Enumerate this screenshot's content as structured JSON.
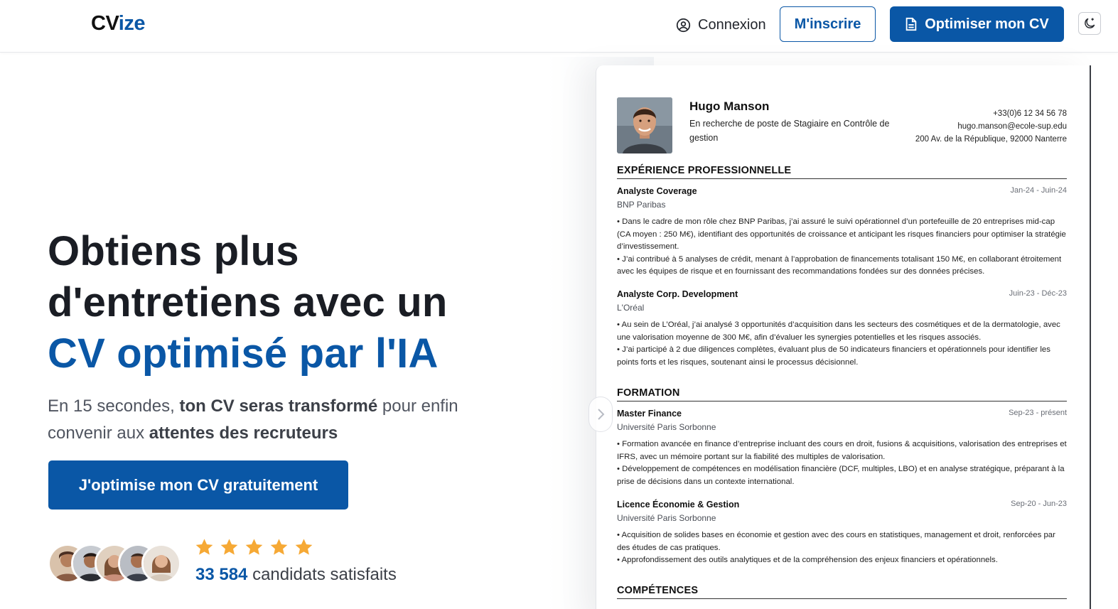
{
  "header": {
    "logo_main": "CV",
    "logo_accent": "ize",
    "login_label": "Connexion",
    "signup_label": "M'inscrire",
    "optimize_label": "Optimiser mon CV"
  },
  "hero": {
    "title_line1": "Obtiens plus",
    "title_line2": "d'entretiens avec un",
    "title_line3": "CV optimisé par l'IA",
    "sub_part1": "En 15 secondes, ",
    "sub_bold1": "ton CV seras transformé",
    "sub_part2": " pour enfin convenir aux ",
    "sub_bold2": "attentes des recruteurs",
    "cta_label": "J'optimise mon CV gratuitement",
    "rating_stars": 5,
    "satisfied_count": "33 584",
    "satisfied_label": " candidats satisfaits"
  },
  "cv": {
    "name": "Hugo Manson",
    "role": "En recherche de poste de Stagiaire en Contrôle de gestion",
    "phone": "+33(0)6 12 34 56 78",
    "email": "hugo.manson@ecole-sup.edu",
    "address": "200 Av. de la République, 92000 Nanterre",
    "sections": {
      "experience": "EXPÉRIENCE PROFESSIONNELLE",
      "formation": "FORMATION",
      "skills": "COMPÉTENCES"
    },
    "experience": [
      {
        "title": "Analyste Coverage",
        "dates": "Jan-24 - Juin-24",
        "org": "BNP Paribas",
        "bullets": [
          "• Dans le cadre de mon rôle chez BNP Paribas, j’ai assuré le suivi opérationnel d’un portefeuille de 20 entreprises mid-cap (CA moyen : 250 M€), identifiant des opportunités de croissance et anticipant les risques financiers pour optimiser la stratégie d’investissement.",
          "• J’ai contribué à 5 analyses de crédit, menant à l’approbation de financements totalisant 150 M€, en collaborant étroitement avec les équipes de risque et en fournissant des recommandations fondées sur des données précises."
        ]
      },
      {
        "title": "Analyste Corp. Development",
        "dates": "Juin-23 - Déc-23",
        "org": "L'Oréal",
        "bullets": [
          "• Au sein de L’Oréal, j’ai analysé 3 opportunités d’acquisition dans les secteurs des cosmétiques et de la dermatologie, avec une valorisation moyenne de 300 M€, afin d’évaluer les synergies potentielles et les risques associés.",
          "• J’ai participé à 2 due diligences complètes, évaluant plus de 50 indicateurs financiers et opérationnels pour identifier les points forts et les risques, soutenant ainsi le processus décisionnel."
        ]
      }
    ],
    "formation": [
      {
        "title": "Master Finance",
        "dates": "Sep-23 - présent",
        "org": "Université Paris Sorbonne",
        "bullets": [
          "• Formation avancée en finance d’entreprise incluant des cours en droit, fusions & acquisitions, valorisation des entreprises et IFRS, avec un mémoire portant sur la fiabilité des multiples de valorisation.",
          "• Développement de compétences en modélisation financière (DCF, multiples, LBO) et en analyse stratégique, préparant à la prise de décisions dans un contexte international."
        ]
      },
      {
        "title": "Licence Économie & Gestion",
        "dates": "Sep-20 - Jun-23",
        "org": "Université Paris Sorbonne",
        "bullets": [
          "• Acquisition de solides bases en économie et gestion avec des cours en statistiques, management et droit, renforcées par des études de cas pratiques.",
          "• Approfondissement des outils analytiques et de la compréhension des enjeux financiers et opérationnels."
        ]
      }
    ]
  },
  "colors": {
    "brand": "#0a57a6",
    "star": "#f6a935",
    "text": "#1a1d24"
  }
}
